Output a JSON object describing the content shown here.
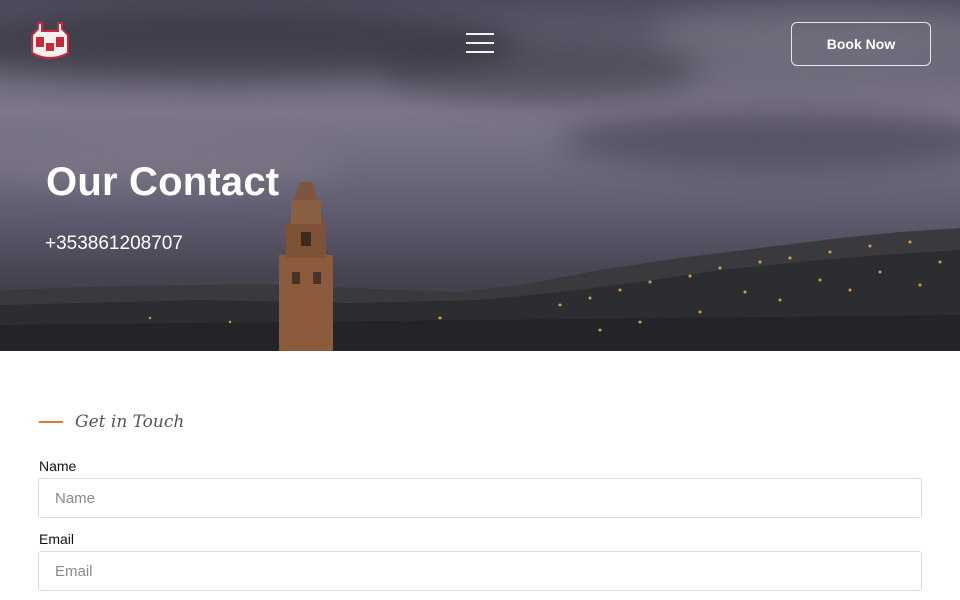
{
  "header": {
    "logo_icon": "castle-logo-icon",
    "menu_icon": "hamburger-menu-icon",
    "book_label": "Book Now"
  },
  "hero": {
    "title": "Our Contact",
    "phone": "+353861208707"
  },
  "form": {
    "section_label": "Get in Touch",
    "name_label": "Name",
    "name_placeholder": "Name",
    "name_value": "",
    "email_label": "Email",
    "email_placeholder": "Email",
    "email_value": ""
  },
  "colors": {
    "accent": "#e07a2e",
    "hero_overlay": "#5f5b6f"
  }
}
